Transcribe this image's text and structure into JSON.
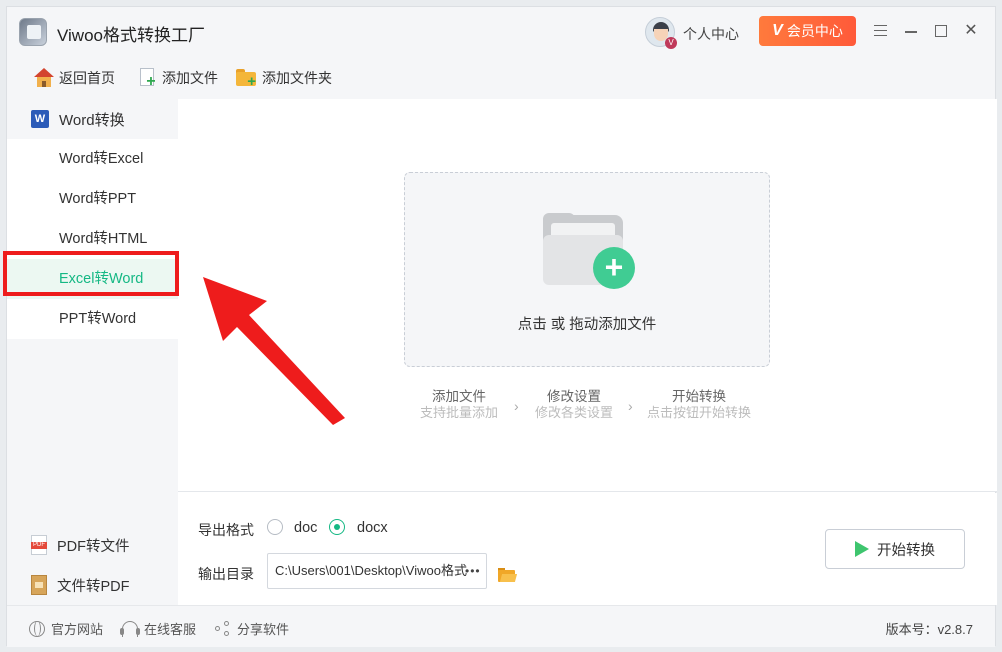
{
  "app": {
    "title": "Viwoo格式转换工厂"
  },
  "header": {
    "user_center": "个人中心",
    "vip_button": "会员中心",
    "vip_badge": "V"
  },
  "toolbar": {
    "home": "返回首页",
    "add_file": "添加文件",
    "add_folder": "添加文件夹"
  },
  "sidebar": {
    "group_label": "Word转换",
    "items": [
      {
        "label": "Word转Excel",
        "active": false
      },
      {
        "label": "Word转PPT",
        "active": false
      },
      {
        "label": "Word转HTML",
        "active": false
      },
      {
        "label": "Excel转Word",
        "active": true
      },
      {
        "label": "PPT转Word",
        "active": false
      }
    ],
    "bottom_items": [
      {
        "label": "PDF转文件",
        "icon": "pdf-icon"
      },
      {
        "label": "文件转PDF",
        "icon": "file-pdf-icon"
      }
    ]
  },
  "dropzone": {
    "text": "点击 或 拖动添加文件"
  },
  "steps": [
    {
      "title": "添加文件",
      "sub": "支持批量添加"
    },
    {
      "title": "修改设置",
      "sub": "修改各类设置"
    },
    {
      "title": "开始转换",
      "sub": "点击按钮开始转换"
    }
  ],
  "settings": {
    "format_label": "导出格式",
    "format_options": [
      "doc",
      "docx"
    ],
    "format_selected": "docx",
    "output_label": "输出目录",
    "output_path": "C:\\Users\\001\\Desktop\\Viwoo格式",
    "output_path_more": "•••",
    "start_button": "开始转换"
  },
  "statusbar": {
    "website": "官方网站",
    "support": "在线客服",
    "share": "分享软件",
    "version": "版本号：v2.8.7"
  },
  "colors": {
    "accent_green": "#15b884",
    "vip_orange": "#ff6a3a",
    "annotation_red": "#ee1c1c"
  }
}
